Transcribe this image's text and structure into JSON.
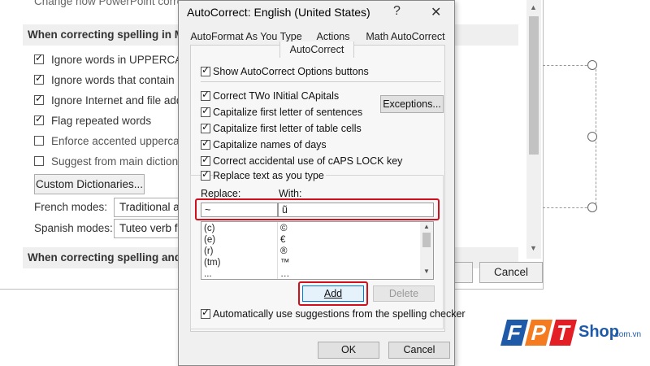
{
  "background": {
    "cut_text": "Change how PowerPoint corrects",
    "section1_title": "When correcting spelling in Mic",
    "options": [
      {
        "label": "Ignore words in UPPERCASE",
        "checked": true
      },
      {
        "label": "Ignore words that contain nu",
        "checked": true
      },
      {
        "label": "Ignore Internet and file addre",
        "checked": true
      },
      {
        "label": "Flag repeated words",
        "checked": true
      },
      {
        "label": "Enforce accented uppercase i",
        "checked": false
      },
      {
        "label": "Suggest from main dictionar",
        "checked": false
      }
    ],
    "custom_dictionaries_label": "Custom Dictionaries...",
    "french_modes_label": "French modes:",
    "french_modes_value": "Traditional an",
    "spanish_modes_label": "Spanish modes:",
    "spanish_modes_value": "Tuteo verb fo",
    "section2_title": "When correcting spelling and gr",
    "cancel_label": "Cancel"
  },
  "dialog": {
    "title": "AutoCorrect: English (United States)",
    "help_glyph": "?",
    "close_glyph": "✕",
    "tabs": [
      "AutoFormat As You Type",
      "Actions",
      "Math AutoCorrect"
    ],
    "active_tab": "AutoCorrect",
    "show_options_label": "Show AutoCorrect Options buttons",
    "checks": [
      {
        "label": "Correct TWo INitial CApitals",
        "checked": true
      },
      {
        "label": "Capitalize first letter of sentences",
        "checked": true
      },
      {
        "label": "Capitalize first letter of table cells",
        "checked": true
      },
      {
        "label": "Capitalize names of days",
        "checked": true
      },
      {
        "label": "Correct accidental use of cAPS LOCK key",
        "checked": true
      },
      {
        "label": "Replace text as you type",
        "checked": true
      }
    ],
    "exceptions_label": "Exceptions...",
    "replace_label": "Replace:",
    "with_label": "With:",
    "replace_value": "~",
    "with_value": "ũ",
    "entries": [
      {
        "from": "(c)",
        "to": "©"
      },
      {
        "from": "(e)",
        "to": "€"
      },
      {
        "from": "(r)",
        "to": "®"
      },
      {
        "from": "(tm)",
        "to": "™"
      },
      {
        "from": "...",
        "to": "…"
      }
    ],
    "add_label": "Add",
    "delete_label": "Delete",
    "auto_suggest_label": "Automatically use suggestions from the spelling checker",
    "ok_label": "OK",
    "cancel_label": "Cancel"
  },
  "logo": {
    "letters": [
      "F",
      "P",
      "T"
    ],
    "suffix": "Shop",
    "domain": ".com.vn",
    "colors": {
      "blue": "#1f5aa8",
      "orange": "#f57b20",
      "red": "#e31e24"
    }
  }
}
